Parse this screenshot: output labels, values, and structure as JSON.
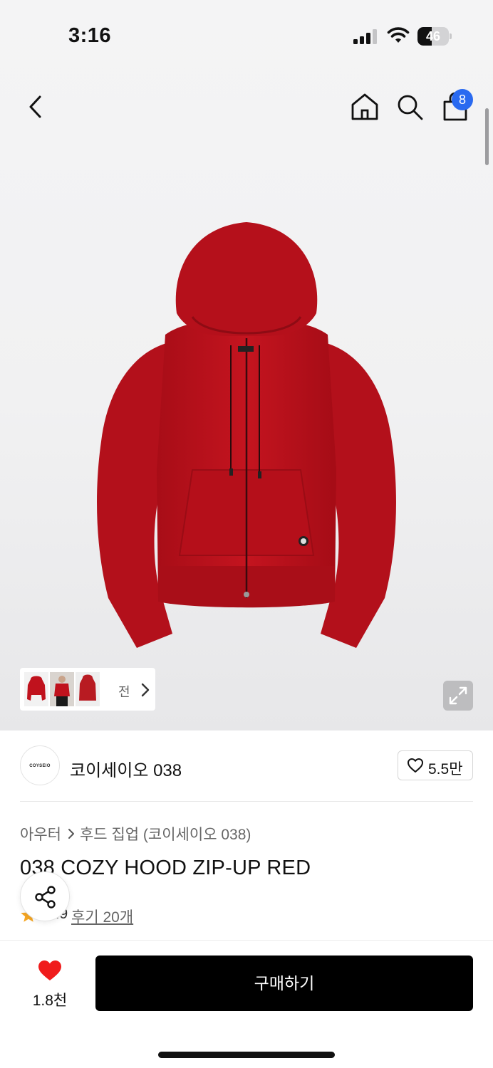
{
  "status_bar": {
    "time": "3:16",
    "battery_level": 46,
    "battery_text": "46"
  },
  "header": {
    "back_icon": "chevron-left-icon",
    "home_icon": "home-icon",
    "search_icon": "search-icon",
    "cart_icon": "shopping-bag-icon",
    "cart_badge": "8",
    "badge_color": "#2a6af0"
  },
  "gallery": {
    "thumbnail_label": "전",
    "thumbnail_count": 3,
    "expand_icon": "expand-icon"
  },
  "brand": {
    "logo_text": "COYSEIO",
    "name": "코이세이오 038",
    "like_count": "5.5만"
  },
  "product": {
    "breadcrumb": [
      "아우터",
      "후드 집업 (코이세이오 038)"
    ],
    "title": "038 COZY HOOD ZIP-UP RED",
    "rating": "4.9",
    "review_link": "후기 20개",
    "color": "#c0121d"
  },
  "share": {
    "icon": "share-icon"
  },
  "bottom_bar": {
    "wish_count": "1.8천",
    "wish_color": "#f01c1c",
    "buy_label": "구매하기"
  }
}
